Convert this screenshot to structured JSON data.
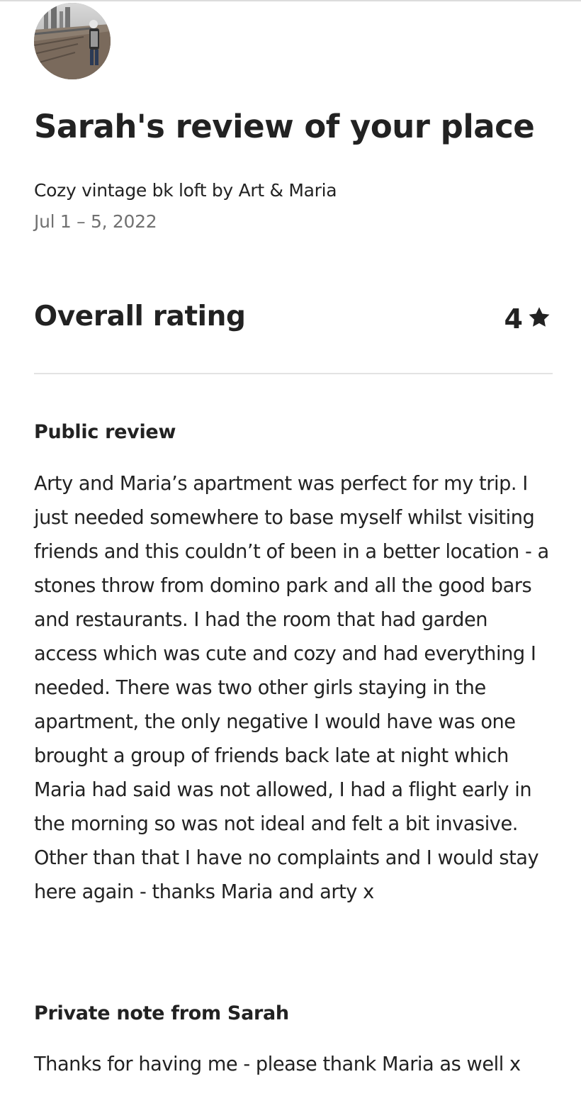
{
  "review": {
    "title": "Sarah's review of your place",
    "listing_name": "Cozy vintage bk loft by Art & Maria",
    "dates": "Jul 1 – 5, 2022"
  },
  "rating": {
    "label": "Overall rating",
    "value": "4",
    "icon": "star-icon"
  },
  "public_review": {
    "heading": "Public review",
    "text": "Arty and Maria’s apartment was perfect for my trip. I just needed somewhere to base myself whilst visiting friends and this couldn’t of been in a better location - a stones throw from domino park and all the good bars and restaurants. I had the room that had garden access which was cute and cozy and had everything I needed. There was two other girls staying in the apartment, the only negative I would have was one brought a group of friends back late at night which Maria had said was not allowed, I had a flight early in the morning so was not ideal and felt a bit invasive. Other than that I have no complaints and I would stay here again - thanks Maria and arty x"
  },
  "private_note": {
    "heading": "Private note from Sarah",
    "text": "Thanks for having me - please thank Maria as well x"
  },
  "colors": {
    "text_primary": "#222222",
    "text_secondary": "#717171",
    "divider": "#e3e3e3"
  }
}
